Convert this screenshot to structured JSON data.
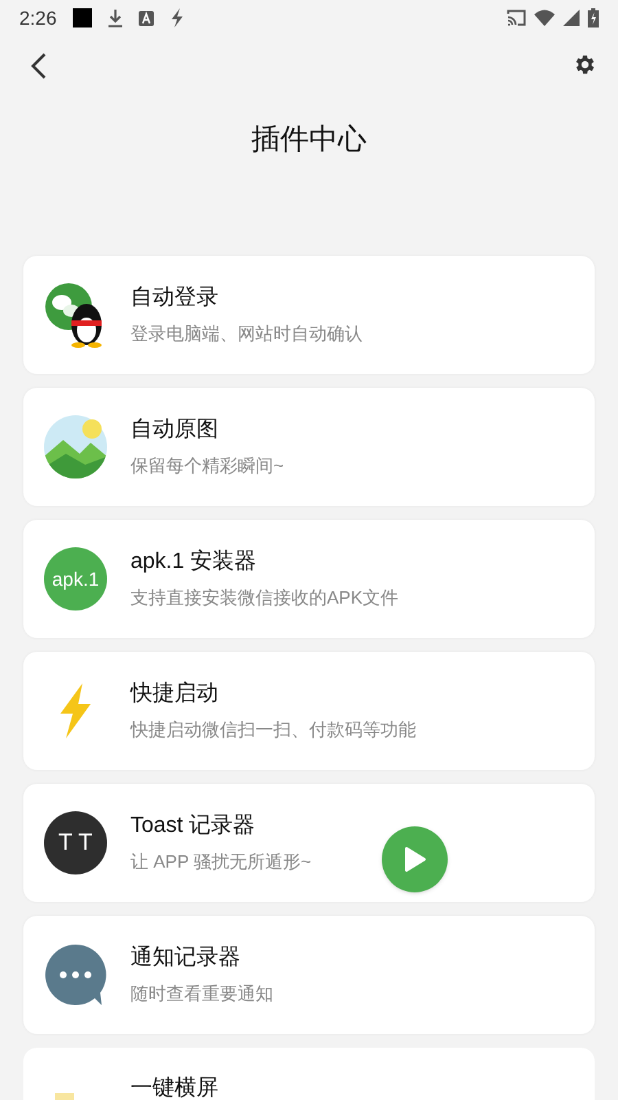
{
  "status_bar": {
    "time": "2:26"
  },
  "header": {
    "title": "插件中心"
  },
  "plugins": [
    {
      "kind": "login",
      "title": "自动登录",
      "subtitle": "登录电脑端、网站时自动确认"
    },
    {
      "kind": "landscape",
      "title": "自动原图",
      "subtitle": "保留每个精彩瞬间~"
    },
    {
      "kind": "apk-badge",
      "badge": "apk.1",
      "title": "apk.1 安装器",
      "subtitle": "支持直接安装微信接收的APK文件"
    },
    {
      "kind": "bolt",
      "title": "快捷启动",
      "subtitle": "快捷启动微信扫一扫、付款码等功能"
    },
    {
      "kind": "initials-badge",
      "badge": "T T",
      "title": "Toast 记录器",
      "subtitle": "让 APP 骚扰无所遁形~"
    },
    {
      "kind": "bubble",
      "title": "通知记录器",
      "subtitle": "随时查看重要通知"
    },
    {
      "kind": "note",
      "title": "一键横屏"
    }
  ]
}
